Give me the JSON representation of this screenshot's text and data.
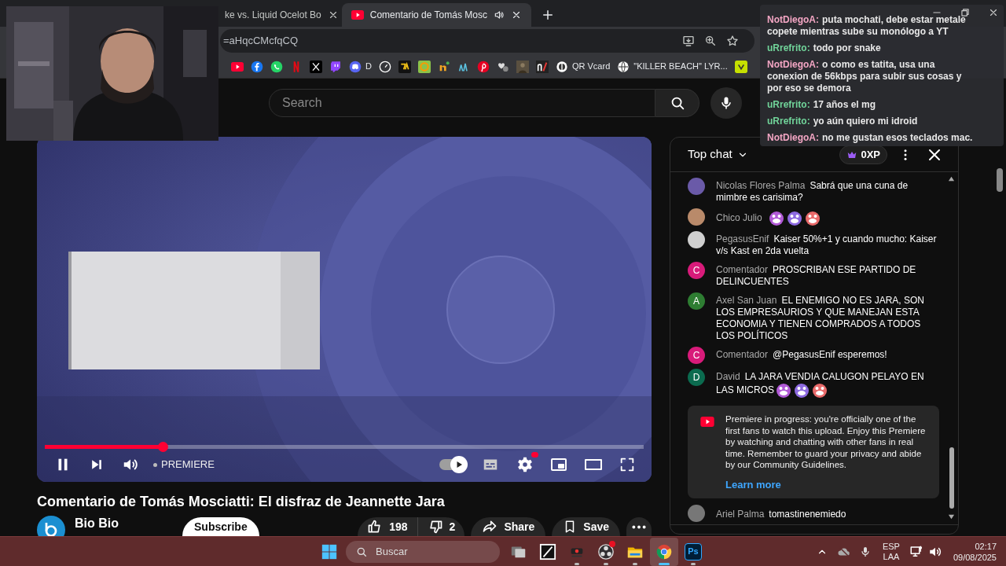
{
  "browser": {
    "tabs": [
      {
        "title": "ke vs. Liquid Ocelot Bo",
        "selected": false,
        "audio": false
      },
      {
        "title": "Comentario de Tomás Mosc",
        "selected": true,
        "audio": true
      }
    ],
    "address": "=aHqcCMcfqCQ",
    "bookmarks": [
      {
        "label": "D"
      },
      {
        "label": "QR Vcard"
      },
      {
        "label": "\"KILLER BEACH\" LYR..."
      }
    ]
  },
  "stream_chat_overlay": [
    {
      "author": "NotDiegoA:",
      "color": "#f4a6c4",
      "text": "puta mochati, debe estar metale copete mientras sube su monólogo a YT"
    },
    {
      "author": "uRrefrito:",
      "color": "#71d49a",
      "text": "todo por snake"
    },
    {
      "author": "NotDiegoA:",
      "color": "#f4a6c4",
      "text": "o como es tatita, usa una conexion de 56kbps para subir sus cosas y por eso se demora"
    },
    {
      "author": "uRrefrito:",
      "color": "#71d49a",
      "text": "17 años el mg"
    },
    {
      "author": "uRrefrito:",
      "color": "#71d49a",
      "text": "yo aún quiero mi idroid"
    },
    {
      "author": "NotDiegoA:",
      "color": "#f4a6c4",
      "text": "no me gustan esos teclados mac."
    }
  ],
  "youtube": {
    "search": {
      "placeholder": "Search"
    },
    "player": {
      "playing": true,
      "level": 0.197,
      "autoplay_on": true,
      "badge": "PREMIERE"
    },
    "video_title": "Comentario de Tomás Mosciatti: El disfraz de Jeannette Jara",
    "channel": "Bio Bio",
    "subscribe": "Subscribe",
    "likes": "198",
    "dislikes": "2",
    "share": "Share",
    "save": "Save",
    "chat": {
      "title": "Top chat",
      "points": "0XP",
      "messages": [
        {
          "author": "Nicolas Flores Palma",
          "text": "Sabrá que una cuna de mimbre es carisima?",
          "avatar": {
            "color": "#6a5aa8"
          }
        },
        {
          "author": "Chico Julio",
          "emotes": true,
          "avatar": {
            "color": "#b98a6a"
          }
        },
        {
          "author": "PegasusEnif",
          "text": "Kaiser 50%+1 y cuando mucho: Kaiser v/s Kast en 2da vuelta",
          "avatar": {
            "color": "#cfcfcf"
          }
        },
        {
          "author": "Comentador",
          "text": "PROSCRIBAN ESE PARTIDO DE DELINCUENTES",
          "avatar": {
            "letter": "C",
            "color": "#d81b7a"
          }
        },
        {
          "author": "Axel San Juan",
          "text": "EL ENEMIGO NO ES JARA, SON LOS EMPRESAURIOS Y QUE MANEJAN ESTA ECONOMIA Y TIENEN COMPRADOS A TODOS LOS POLÍTICOS",
          "avatar": {
            "letter": "A",
            "color": "#2e7d32"
          }
        },
        {
          "author": "Comentador",
          "text": "@PegasusEnif esperemos!",
          "avatar": {
            "letter": "C",
            "color": "#d81b7a"
          }
        },
        {
          "author": "David",
          "text": "LA JARA VENDIA CALUGON PELAYO EN LAS MICROS",
          "emotes": true,
          "avatar": {
            "letter": "D",
            "color": "#0b6b4f"
          }
        }
      ],
      "notice": {
        "text": "Premiere in progress: you're officially one of the first fans to watch this upload. Enjoy this Premiere by watching and chatting with other fans in real time. Remember to guard your privacy and abide by our Community Guidelines.",
        "link": "Learn more"
      },
      "last_message": {
        "author": "Ariel Palma",
        "text": "tomastinenemiedo",
        "avatar": {
          "color": "#777777"
        }
      }
    }
  },
  "taskbar": {
    "search": "Buscar",
    "apps": [
      {
        "running": false,
        "selected": false,
        "notification": false
      },
      {
        "running": false,
        "selected": false,
        "notification": false
      },
      {
        "running": true,
        "selected": false,
        "notification": false
      },
      {
        "running": true,
        "selected": false,
        "notification": true
      },
      {
        "running": true,
        "selected": false,
        "notification": false
      },
      {
        "running": true,
        "selected": true,
        "notification": false
      },
      {
        "running": true,
        "selected": false,
        "notification": false,
        "label": "Ps"
      }
    ],
    "language": "ESP",
    "layout": "LAA",
    "time": "02:17",
    "date": "09/08/2025"
  }
}
